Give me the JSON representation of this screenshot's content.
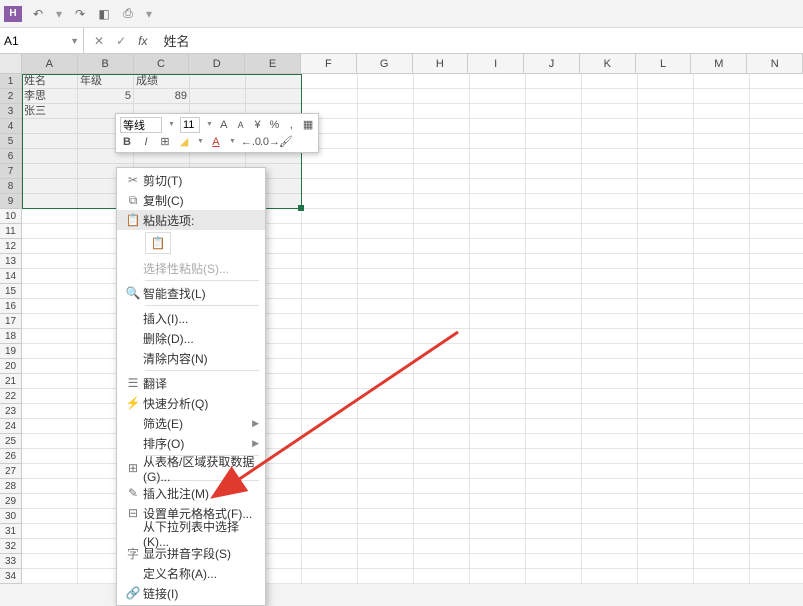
{
  "quick_access": {
    "save_label": "H"
  },
  "namebox": {
    "value": "A1"
  },
  "formula": {
    "value": "姓名"
  },
  "columns": [
    "A",
    "B",
    "C",
    "D",
    "E",
    "F",
    "G",
    "H",
    "I",
    "J",
    "K",
    "L",
    "M",
    "N"
  ],
  "selected_cols": [
    "A",
    "B",
    "C",
    "D",
    "E"
  ],
  "rows": [
    "1",
    "2",
    "3",
    "4",
    "5",
    "6",
    "7",
    "8",
    "9",
    "10",
    "11",
    "12",
    "13",
    "14",
    "15",
    "16",
    "17",
    "18",
    "19",
    "20",
    "21",
    "22",
    "23",
    "24",
    "25",
    "26",
    "27",
    "28",
    "29",
    "30",
    "31",
    "32",
    "33",
    "34"
  ],
  "selected_rows": [
    "1",
    "2",
    "3",
    "4",
    "5",
    "6",
    "7",
    "8",
    "9"
  ],
  "data": {
    "r1": {
      "A": "姓名",
      "B": "年级",
      "C": "成绩"
    },
    "r2": {
      "A": "李思",
      "B": "5",
      "C": "89"
    },
    "r3": {
      "A": "张三"
    }
  },
  "mini_toolbar": {
    "font_name": "等线",
    "font_size": "11",
    "increase_font": "A",
    "decrease_font": "A",
    "percent": "%",
    "comma": ",",
    "bold": "B",
    "italic": "I"
  },
  "context_menu": {
    "items": [
      {
        "icon": "✂",
        "label": "剪切(T)",
        "type": "item"
      },
      {
        "icon": "⧉",
        "label": "复制(C)",
        "type": "item"
      },
      {
        "icon": "📋",
        "label": "粘贴选项:",
        "type": "header",
        "highlighted": true
      },
      {
        "type": "paste-option"
      },
      {
        "label": "选择性粘贴(S)...",
        "type": "item",
        "disabled": true
      },
      {
        "type": "sep"
      },
      {
        "icon": "🔍",
        "label": "智能查找(L)",
        "type": "item"
      },
      {
        "type": "sep"
      },
      {
        "label": "插入(I)...",
        "type": "item"
      },
      {
        "label": "删除(D)...",
        "type": "item"
      },
      {
        "label": "清除内容(N)",
        "type": "item"
      },
      {
        "type": "sep"
      },
      {
        "icon": "☰",
        "label": "翻译",
        "type": "item"
      },
      {
        "icon": "⚡",
        "label": "快速分析(Q)",
        "type": "item"
      },
      {
        "label": "筛选(E)",
        "type": "item",
        "submenu": true
      },
      {
        "label": "排序(O)",
        "type": "item",
        "submenu": true
      },
      {
        "type": "sep"
      },
      {
        "icon": "⊞",
        "label": "从表格/区域获取数据(G)...",
        "type": "item"
      },
      {
        "type": "sep"
      },
      {
        "icon": "✎",
        "label": "插入批注(M)",
        "type": "item"
      },
      {
        "icon": "⊟",
        "label": "设置单元格格式(F)...",
        "type": "item"
      },
      {
        "label": "从下拉列表中选择(K)...",
        "type": "item"
      },
      {
        "icon": "字",
        "label": "显示拼音字段(S)",
        "type": "item"
      },
      {
        "label": "定义名称(A)...",
        "type": "item"
      },
      {
        "icon": "🔗",
        "label": "链接(I)",
        "type": "item"
      }
    ]
  }
}
